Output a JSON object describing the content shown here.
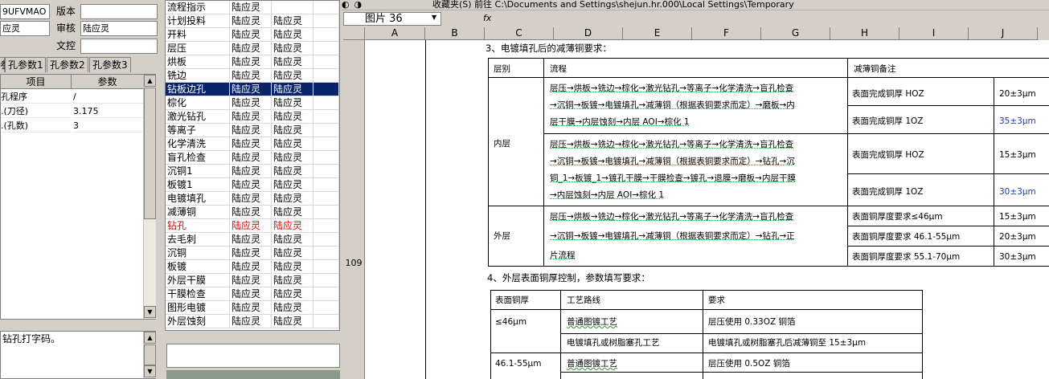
{
  "left_panel": {
    "top_value": "9UFVMAO",
    "version_label": "版本",
    "left_field_2": "应灵",
    "reviewer_label": "审核",
    "reviewer_value": "陆应灵",
    "docctrl_label": "文控",
    "tabs": [
      "孔参数",
      "孔参数1",
      "孔参数2",
      "孔参数3"
    ],
    "grid_headers": [
      "项目",
      "参数"
    ],
    "grid_rows": [
      {
        "item": "孔程序",
        "value": "/"
      },
      {
        "item": ".(刀径)",
        "value": "3.175"
      },
      {
        "item": ".(孔数)",
        "value": "3"
      }
    ],
    "memo_text": "钻孔打字码。"
  },
  "process_list": [
    {
      "name": "流程指示",
      "a": "陆应灵",
      "b": ""
    },
    {
      "name": "计划投料",
      "a": "陆应灵",
      "b": "陆应灵"
    },
    {
      "name": "开料",
      "a": "陆应灵",
      "b": "陆应灵"
    },
    {
      "name": "层压",
      "a": "陆应灵",
      "b": "陆应灵"
    },
    {
      "name": "烘板",
      "a": "陆应灵",
      "b": "陆应灵"
    },
    {
      "name": "铣边",
      "a": "陆应灵",
      "b": "陆应灵"
    },
    {
      "name": "钻板边孔",
      "a": "陆应灵",
      "b": "陆应灵"
    },
    {
      "name": "棕化",
      "a": "陆应灵",
      "b": "陆应灵"
    },
    {
      "name": "激光钻孔",
      "a": "陆应灵",
      "b": "陆应灵"
    },
    {
      "name": "等离子",
      "a": "陆应灵",
      "b": "陆应灵"
    },
    {
      "name": "化学清洗",
      "a": "陆应灵",
      "b": "陆应灵"
    },
    {
      "name": "盲孔检查",
      "a": "陆应灵",
      "b": "陆应灵"
    },
    {
      "name": "沉铜1",
      "a": "陆应灵",
      "b": "陆应灵"
    },
    {
      "name": "板镀1",
      "a": "陆应灵",
      "b": "陆应灵"
    },
    {
      "name": "电镀填孔",
      "a": "陆应灵",
      "b": "陆应灵"
    },
    {
      "name": "减薄铜",
      "a": "陆应灵",
      "b": "陆应灵"
    },
    {
      "name": "钻孔",
      "a": "陆应灵",
      "b": "陆应灵"
    },
    {
      "name": "去毛刺",
      "a": "陆应灵",
      "b": "陆应灵"
    },
    {
      "name": "沉铜",
      "a": "陆应灵",
      "b": "陆应灵"
    },
    {
      "name": "板镀",
      "a": "陆应灵",
      "b": "陆应灵"
    },
    {
      "name": "外层干膜",
      "a": "陆应灵",
      "b": "陆应灵"
    },
    {
      "name": "干膜检查",
      "a": "陆应灵",
      "b": "陆应灵"
    },
    {
      "name": "图形电镀",
      "a": "陆应灵",
      "b": "陆应灵"
    },
    {
      "name": "外层蚀刻",
      "a": "陆应灵",
      "b": "陆应灵"
    }
  ],
  "process_selected_index": 6,
  "process_red_index": 16,
  "spreadsheet": {
    "toolbar_text": "收藏夹(S)   前往   C:\\Documents and Settings\\shejun.hr.000\\Local Settings\\Temporary",
    "name_box": "图片 36",
    "fx": "fx",
    "columns": [
      "A",
      "B",
      "C",
      "D",
      "E",
      "F",
      "G",
      "H",
      "I",
      "J"
    ],
    "row_number": "109",
    "section3_title": "3、电镀填孔后的减薄铜要求：",
    "table3_headers": [
      "层别",
      "流程",
      "减薄铜备注"
    ],
    "inner_label": "内层",
    "outer_label": "外层",
    "inner_flow_1": [
      "层压→烘板→铣边→棕化→激光钻孔→等离子→化学清洗→盲孔检查",
      "→沉铜→板镀→电镀填孔→减薄铜（根据表铜要求而定）→磨板→内",
      "层干膜→内层蚀刻→内层 AOI→棕化 1"
    ],
    "inner_flow_2": [
      "层压→烘板→铣边→棕化→激光钻孔→等离子→化学清洗→盲孔检查",
      "→沉铜→板镀→电镀填孔→减薄铜（根据表铜要求而定）→钻孔→沉",
      "铜_1→板镀_1→镀孔干膜→干膜检查→镀孔→退膜→磨板→内层干膜",
      "→内层蚀刻→内层 AOI→棕化 1"
    ],
    "outer_flow": [
      "层压→烘板→铣边→棕化→激光钻孔→等离子→化学清洗→盲孔检查",
      "→沉铜→板镀→电镀填孔→减薄铜（根据表铜要求而定）→钻孔→正",
      "片流程"
    ],
    "remarks": [
      {
        "text": "表面完成铜厚 HOZ",
        "value": "20±3μm"
      },
      {
        "text": "表面完成铜厚 1OZ",
        "value": "35±3μm"
      },
      {
        "text": "表面完成铜厚 HOZ",
        "value": "15±3μm"
      },
      {
        "text": "表面完成铜厚 1OZ",
        "value": "30±3μm"
      },
      {
        "text": "表面铜厚度要求≤46μm",
        "value": "15±3μm"
      },
      {
        "text": "表面铜厚度要求 46.1-55μm",
        "value": "20±3μm"
      },
      {
        "text": "表面铜厚度要求 55.1-70μm",
        "value": "30±3μm"
      }
    ],
    "section4_title": "4、外层表面铜厚控制，参数填写要求：",
    "table4_headers": [
      "表面铜厚",
      "工艺路线",
      "要求"
    ],
    "table4_rows": [
      {
        "thick": "≤46μm",
        "route": "普通图镀工艺",
        "req": "层压使用 0.33OZ 铜箔"
      },
      {
        "thick": "",
        "route": "电镀填孔或树脂塞孔工艺",
        "req": "电镀填孔或树脂塞孔后减薄铜至 15±3μm"
      },
      {
        "thick": "46.1-55μm",
        "route": "普通图镀工艺",
        "req": "层压使用 0.5OZ 铜箔"
      }
    ]
  }
}
